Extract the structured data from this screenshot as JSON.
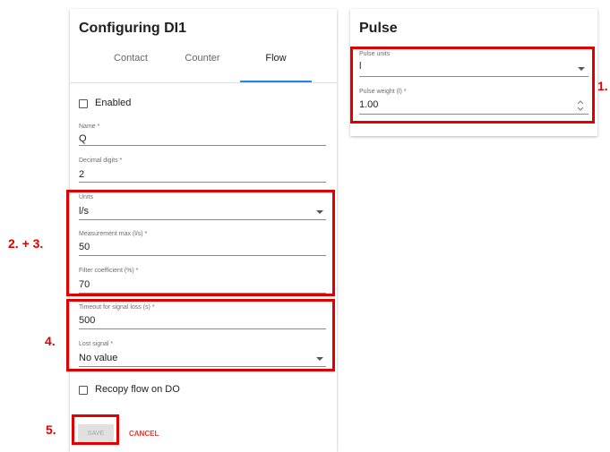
{
  "left_panel": {
    "title": "Configuring DI1",
    "tabs": [
      {
        "label": "Contact",
        "active": false
      },
      {
        "label": "Counter",
        "active": false
      },
      {
        "label": "Flow",
        "active": true
      }
    ],
    "enabled_label": "Enabled",
    "fields": {
      "name": {
        "label": "Name *",
        "value": "Q"
      },
      "decimal_digits": {
        "label": "Decimal digits *",
        "value": "2"
      },
      "units": {
        "label": "Units",
        "value": "l/s"
      },
      "measurement_max": {
        "label": "Measurement max (l/s) *",
        "value": "50"
      },
      "filter_coefficient": {
        "label": "Filter coefficient (%) *",
        "value": "70"
      },
      "timeout": {
        "label": "Timeout for signal loss (s) *",
        "value": "500"
      },
      "lost_signal": {
        "label": "Lost signal *",
        "value": "No value"
      }
    },
    "recopy_label": "Recopy flow on DO",
    "save_label": "SAVE",
    "cancel_label": "CANCEL"
  },
  "right_panel": {
    "title": "Pulse",
    "fields": {
      "pulse_units": {
        "label": "Pulse units",
        "value": "l"
      },
      "pulse_weight": {
        "label": "Pulse weight (l) *",
        "value": "1.00"
      }
    }
  },
  "annotations": {
    "step1": "1.",
    "step23": "2. + 3.",
    "step4": "4.",
    "step5": "5."
  },
  "colors": {
    "annotation_red": "#e10000",
    "tab_indicator": "#1e88e5",
    "cancel_text": "#e53935"
  }
}
